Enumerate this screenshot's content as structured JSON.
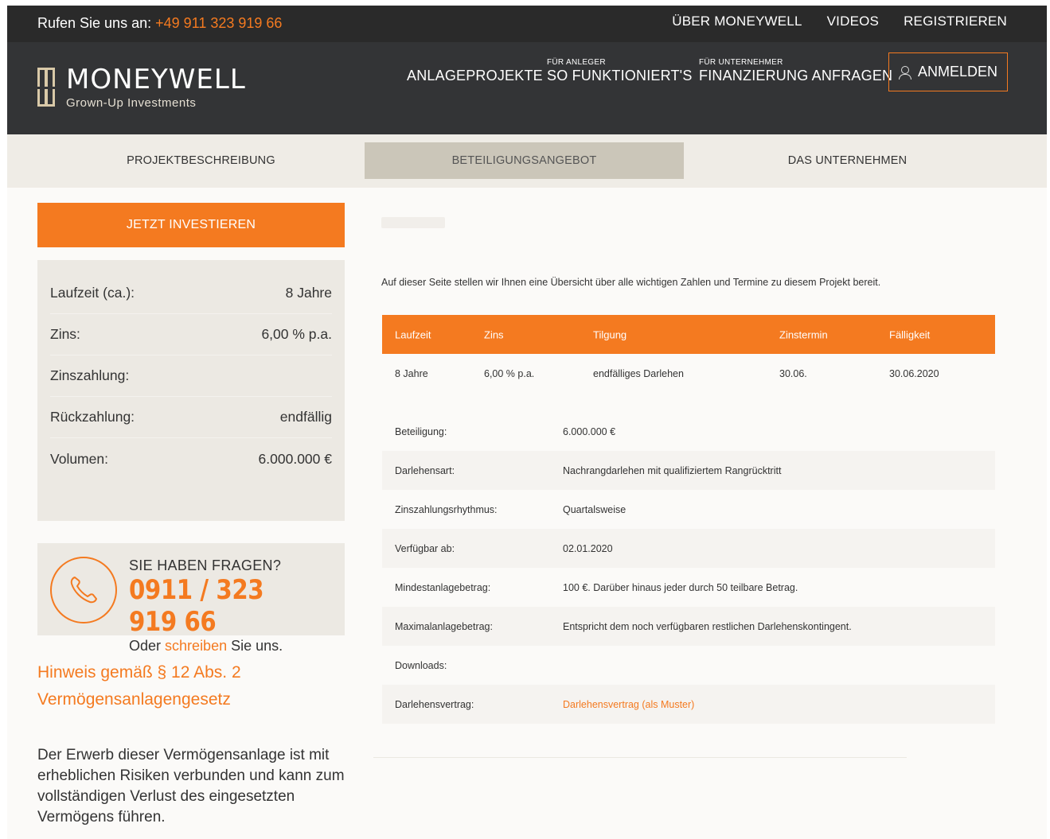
{
  "topbar": {
    "phone_label": "Rufen Sie uns an:",
    "phone_number": "+49 911 323 919 66",
    "links": [
      "ÜBER MONEYWELL",
      "VIDEOS",
      "REGISTRIEREN"
    ]
  },
  "header": {
    "brand": "MONEYWELL",
    "tagline": "Grown-Up Investments",
    "nav": [
      {
        "small": "",
        "label": "ANLAGEPROJEKTE"
      },
      {
        "small": "FÜR ANLEGER",
        "label": "SO FUNKTIONIERT'S"
      },
      {
        "small": "FÜR UNTERNEHMER",
        "label": "FINANZIERUNG ANFRAGEN"
      }
    ],
    "login_label": "ANMELDEN"
  },
  "tabs": [
    "PROJEKTBESCHREIBUNG",
    "BETEILIGUNGSANGEBOT",
    "DAS UNTERNEHMEN"
  ],
  "sidebar": {
    "invest_label": "JETZT INVESTIEREN",
    "facts": [
      {
        "label": "Laufzeit (ca.):",
        "value": "8 Jahre"
      },
      {
        "label": "Zins:",
        "value": "6,00 % p.a."
      },
      {
        "label": "Zinszahlung:",
        "value": ""
      },
      {
        "label": "Rückzahlung:",
        "value": "endfällig"
      },
      {
        "label": "Volumen:",
        "value": "6.000.000 €"
      }
    ],
    "questions": {
      "title": "SIE HABEN FRAGEN?",
      "phone": "0911 / 323 919 66",
      "write_pre": "Oder",
      "write_link": "schreiben",
      "write_post": "Sie uns."
    },
    "hinweis_title": "Hinweis gemäß § 12 Abs. 2 Vermögensanlagengesetz",
    "hinweis_text": "Der Erwerb dieser Vermögensanlage ist mit erheblichen Risiken verbunden und kann zum vollständigen Verlust des eingesetzten Vermögens führen."
  },
  "main": {
    "intro": "Auf dieser Seite stellen wir Ihnen eine Übersicht über alle wichtigen Zahlen und Termine zu diesem Projekt bereit.",
    "terms_headers": [
      "Laufzeit",
      "Zins",
      "Tilgung",
      "Zinstermin",
      "Fälligkeit"
    ],
    "terms_values": [
      "8 Jahre",
      "6,00 % p.a.",
      "endfälliges Darlehen",
      "30.06.",
      "30.06.2020"
    ],
    "details": [
      {
        "label": "Beteiligung:",
        "value": "6.000.000 €"
      },
      {
        "label": "Darlehensart:",
        "value": "Nachrangdarlehen mit qualifiziertem Rangrücktritt"
      },
      {
        "label": "Zinszahlungsrhythmus:",
        "value": "Quartalsweise"
      },
      {
        "label": "Verfügbar ab:",
        "value": "02.01.2020"
      },
      {
        "label": "Mindestanlagebetrag:",
        "value": "100 €. Darüber hinaus jeder durch 50 teilbare Betrag."
      },
      {
        "label": "Maximalanlagebetrag:",
        "value": "Entspricht dem noch verfügbaren restlichen Darlehenskontingent."
      },
      {
        "label": "Downloads:",
        "value": ""
      },
      {
        "label": "Darlehensvertrag:",
        "value": "Darlehensvertrag (als Muster)"
      }
    ]
  },
  "colors": {
    "accent": "#f47a20",
    "dark": "#2a2a2a",
    "header": "#333436",
    "panel": "#ece9e3"
  }
}
